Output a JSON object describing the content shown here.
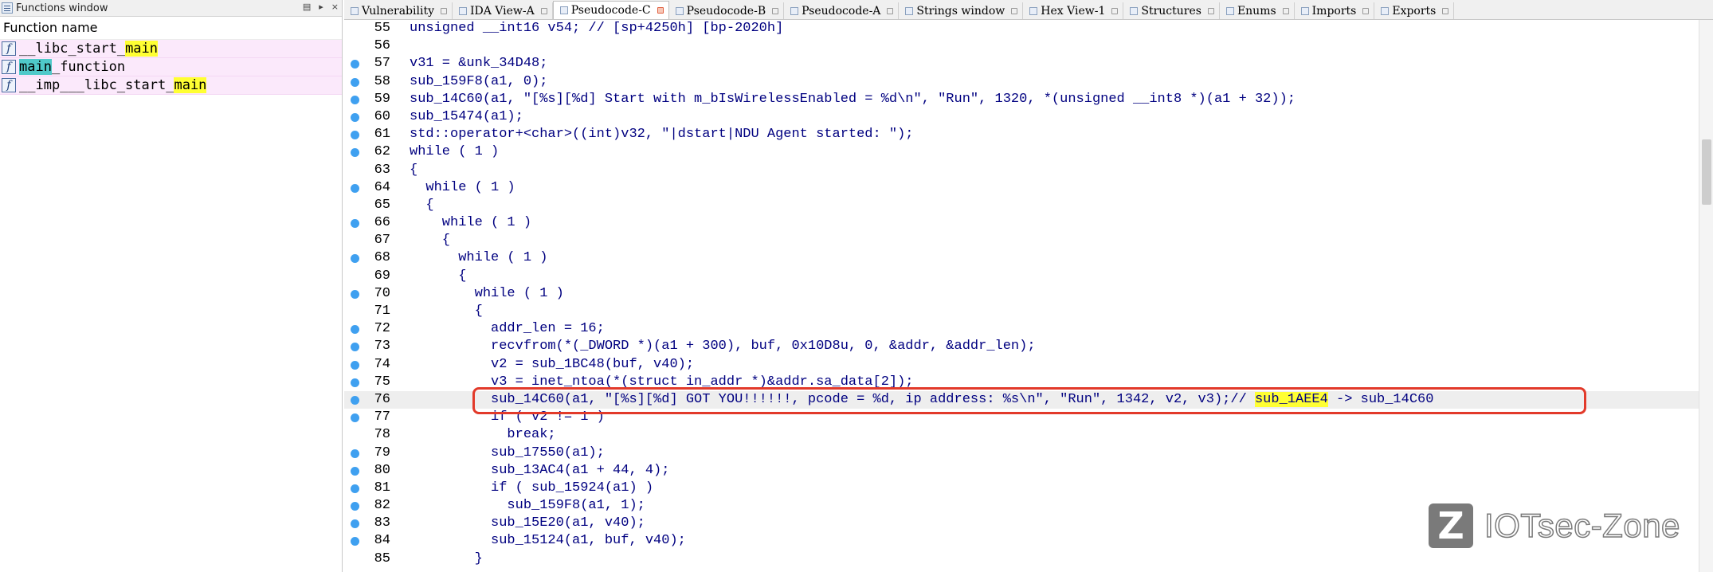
{
  "functions_window": {
    "title": "Functions window",
    "column_header": "Function name",
    "items": [
      {
        "icon": "f",
        "pre": "__libc_start_",
        "hl": "main",
        "post": "",
        "hl_color": "yellow"
      },
      {
        "icon": "f",
        "pre": "",
        "hl": "main",
        "post": "_function",
        "hl_color": "teal"
      },
      {
        "icon": "f",
        "pre": "__imp___libc_start_",
        "hl": "main",
        "post": "",
        "hl_color": "yellow"
      }
    ]
  },
  "tabs": [
    {
      "label": "Vulnerability",
      "active": false
    },
    {
      "label": "IDA View-A",
      "active": false
    },
    {
      "label": "Pseudocode-C",
      "active": true
    },
    {
      "label": "Pseudocode-B",
      "active": false
    },
    {
      "label": "Pseudocode-A",
      "active": false
    },
    {
      "label": "Strings window",
      "active": false
    },
    {
      "label": "Hex View-1",
      "active": false
    },
    {
      "label": "Structures",
      "active": false
    },
    {
      "label": "Enums",
      "active": false
    },
    {
      "label": "Imports",
      "active": false
    },
    {
      "label": "Exports",
      "active": false
    }
  ],
  "code": {
    "current_line": 76,
    "lines": [
      {
        "n": "55",
        "bp": false,
        "t": "unsigned __int16 v54; // [sp+4250h] [bp-2020h]"
      },
      {
        "n": "56",
        "bp": false,
        "t": ""
      },
      {
        "n": "57",
        "bp": true,
        "t": "v31 = &unk_34D48;"
      },
      {
        "n": "58",
        "bp": true,
        "t": "sub_159F8(a1, 0);"
      },
      {
        "n": "59",
        "bp": true,
        "t": "sub_14C60(a1, \"[%s][%d] Start with m_bIsWirelessEnabled = %d\\n\", \"Run\", 1320, *(unsigned __int8 *)(a1 + 32));"
      },
      {
        "n": "60",
        "bp": true,
        "t": "sub_15474(a1);"
      },
      {
        "n": "61",
        "bp": true,
        "t": "std::operator+<char>((int)v32, \"|dstart|NDU Agent started: \");"
      },
      {
        "n": "62",
        "bp": true,
        "t": "while ( 1 )"
      },
      {
        "n": "63",
        "bp": false,
        "t": "{"
      },
      {
        "n": "64",
        "bp": true,
        "t": "  while ( 1 )"
      },
      {
        "n": "65",
        "bp": false,
        "t": "  {"
      },
      {
        "n": "66",
        "bp": true,
        "t": "    while ( 1 )"
      },
      {
        "n": "67",
        "bp": false,
        "t": "    {"
      },
      {
        "n": "68",
        "bp": true,
        "t": "      while ( 1 )"
      },
      {
        "n": "69",
        "bp": false,
        "t": "      {"
      },
      {
        "n": "70",
        "bp": true,
        "t": "        while ( 1 )"
      },
      {
        "n": "71",
        "bp": false,
        "t": "        {"
      },
      {
        "n": "72",
        "bp": true,
        "t": "          addr_len = 16;"
      },
      {
        "n": "73",
        "bp": true,
        "t": "          recvfrom(*(_DWORD *)(a1 + 300), buf, 0x10D8u, 0, &addr, &addr_len);"
      },
      {
        "n": "74",
        "bp": true,
        "t": "          v2 = sub_1BC48(buf, v40);"
      },
      {
        "n": "75",
        "bp": true,
        "t": "          v3 = inet_ntoa(*(struct in_addr *)&addr.sa_data[2]);"
      },
      {
        "n": "76",
        "bp": true,
        "t": "          sub_14C60(a1, \"[%s][%d] GOT YOU!!!!!!, pcode = %d, ip address: %s\\n\", \"Run\", 1342, v2, v3);// sub_1AEE4 -> sub_14C60"
      },
      {
        "n": "77",
        "bp": true,
        "t": "          if ( v2 != 1 )"
      },
      {
        "n": "78",
        "bp": false,
        "t": "            break;"
      },
      {
        "n": "79",
        "bp": true,
        "t": "          sub_17550(a1);"
      },
      {
        "n": "80",
        "bp": true,
        "t": "          sub_13AC4(a1 + 44, 4);"
      },
      {
        "n": "81",
        "bp": true,
        "t": "          if ( sub_15924(a1) )"
      },
      {
        "n": "82",
        "bp": true,
        "t": "            sub_159F8(a1, 1);"
      },
      {
        "n": "83",
        "bp": true,
        "t": "          sub_15E20(a1, v40);"
      },
      {
        "n": "84",
        "bp": true,
        "t": "          sub_15124(a1, buf, v40);"
      },
      {
        "n": "85",
        "bp": false,
        "t": "        }"
      }
    ],
    "line_76_parts": {
      "pre": "          sub_14C60(a1, \"[%s][%d] GOT YOU!!!!!!, pcode = %d, ip address: %s\\n\", \"Run\", 1342, v2, v3);// ",
      "hl": "sub_1AEE4",
      "post": " -> sub_14C60"
    }
  },
  "watermark": {
    "text": "IOTsec-Zone",
    "logo_letter": "Z"
  },
  "colors": {
    "highlight_box": "#e23a2a",
    "breakpoint": "#3fa0f0",
    "search_highlight": "#ffff33"
  }
}
